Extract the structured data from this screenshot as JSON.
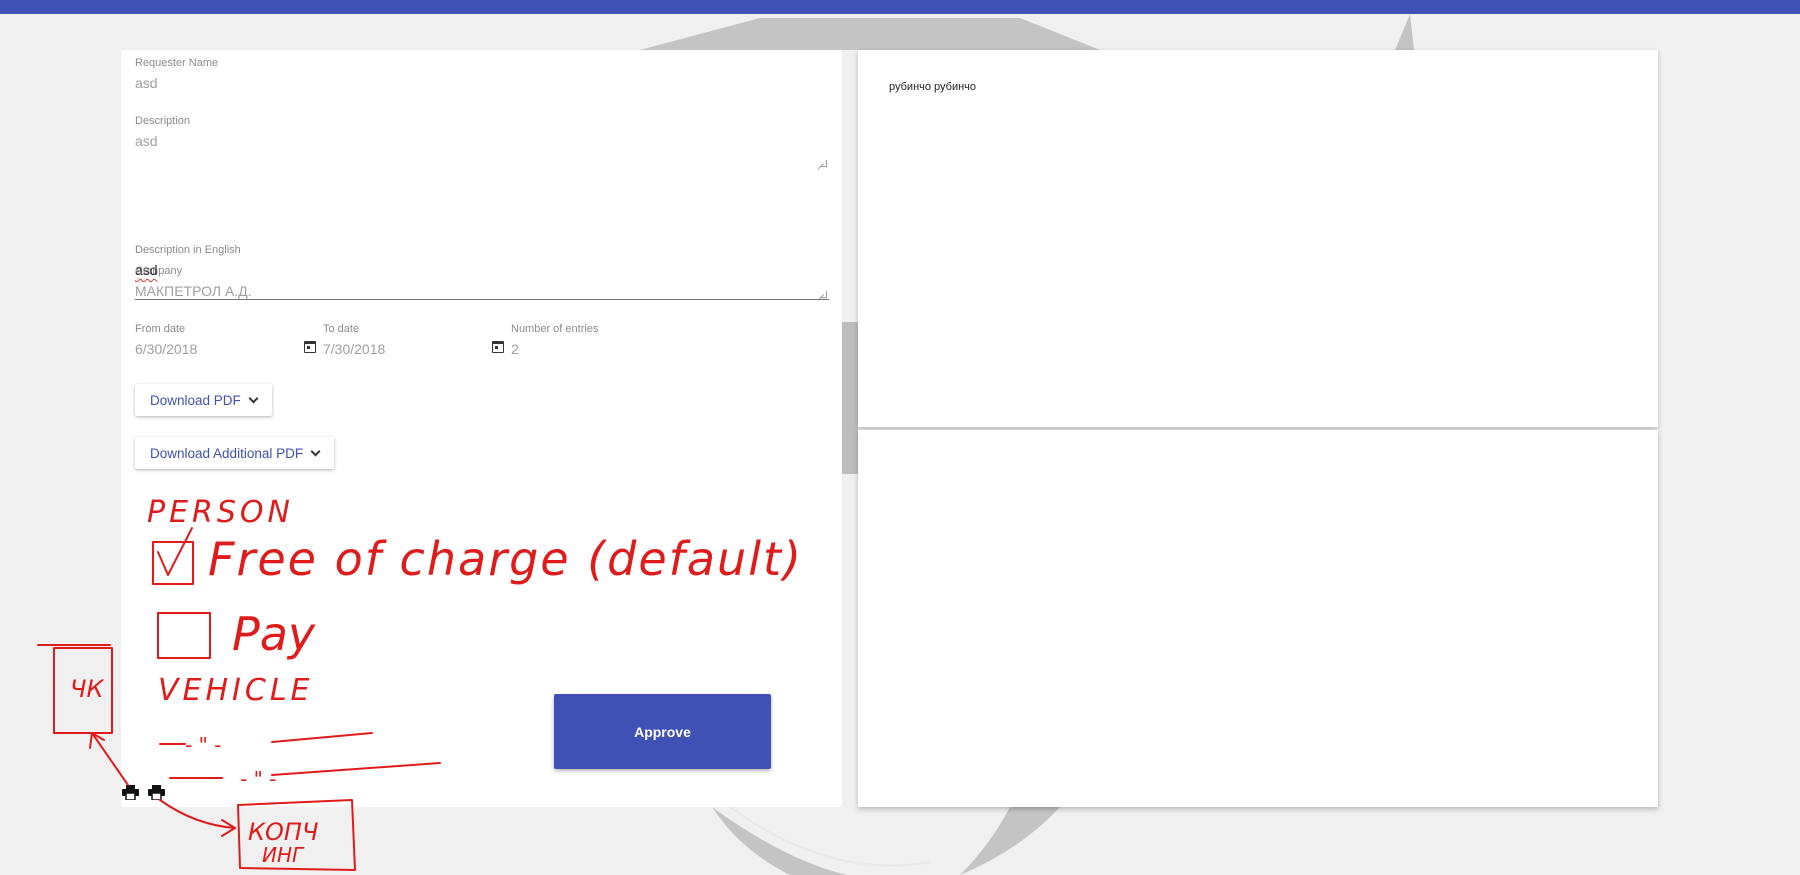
{
  "form": {
    "requester_name": {
      "label": "Requester Name",
      "value": "asd"
    },
    "description": {
      "label": "Description",
      "value": "asd"
    },
    "description_english": {
      "label": "Description in English",
      "value": "asd"
    },
    "company": {
      "label": "Company",
      "value": "МАКПЕТРОЛ А.Д."
    },
    "from_date": {
      "label": "From date",
      "value": "6/30/2018"
    },
    "to_date": {
      "label": "To date",
      "value": "7/30/2018"
    },
    "entries": {
      "label": "Number of entries",
      "value": "2"
    }
  },
  "buttons": {
    "download_pdf": "Download PDF",
    "download_additional_pdf": "Download Additional PDF",
    "approve": "Approve"
  },
  "right_panel": {
    "text": "рубинчо рубинчо"
  },
  "icons": {
    "calendar": "calendar-icon",
    "chevron": "chevron-down-icon",
    "printer": "printer-icon"
  },
  "annotations": {
    "line1": "PERSON",
    "line2": "Free of charge (default)",
    "line3": "Pay",
    "line4": "VEHICLE",
    "line5": "- \" -",
    "line6": "- \" -",
    "box_left": "ЧК",
    "box_bottom_1": "КОПЧ",
    "box_bottom_2": "ИНГ"
  },
  "colors": {
    "primary": "#3f51b5",
    "annotation": "#e01b1b"
  }
}
